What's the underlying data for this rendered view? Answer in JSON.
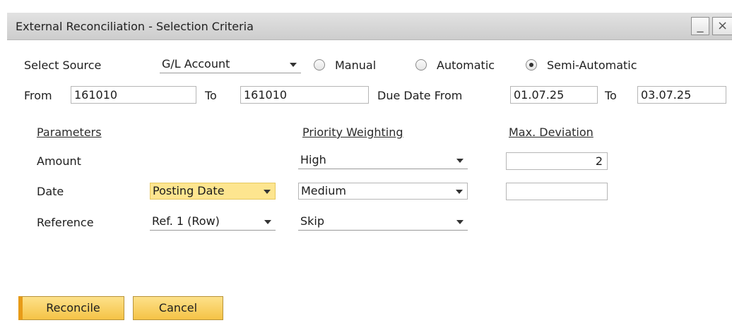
{
  "window": {
    "title": "External Reconciliation - Selection Criteria",
    "minimize_glyph": "_",
    "close_glyph": "×"
  },
  "source": {
    "label": "Select Source",
    "value": "G/L Account",
    "options_radio": [
      {
        "label": "Manual",
        "selected": false
      },
      {
        "label": "Automatic",
        "selected": false
      },
      {
        "label": "Semi-Automatic",
        "selected": true
      }
    ]
  },
  "range": {
    "from_label": "From",
    "from_value": "161010",
    "to_label": "To",
    "to_value": "161010",
    "due_date_from_label": "Due Date From",
    "due_date_from_value": "01.07.25",
    "due_to_label": "To",
    "due_to_value": "03.07.25"
  },
  "parameters": {
    "header_parameters": "Parameters",
    "header_priority": "Priority Weighting",
    "header_deviation": "Max. Deviation",
    "rows": [
      {
        "name": "Amount",
        "subtype": "",
        "priority": "High",
        "deviation": "2"
      },
      {
        "name": "Date",
        "subtype": "Posting Date",
        "priority": "Medium",
        "deviation": ""
      },
      {
        "name": "Reference",
        "subtype": "Ref. 1 (Row)",
        "priority": "Skip",
        "deviation": ""
      }
    ]
  },
  "actions": {
    "reconcile": "Reconcile",
    "cancel": "Cancel"
  },
  "colors": {
    "button_fill": "#f5c346",
    "highlight_field": "#fde58f",
    "titlebar": "#d6d6d6"
  }
}
